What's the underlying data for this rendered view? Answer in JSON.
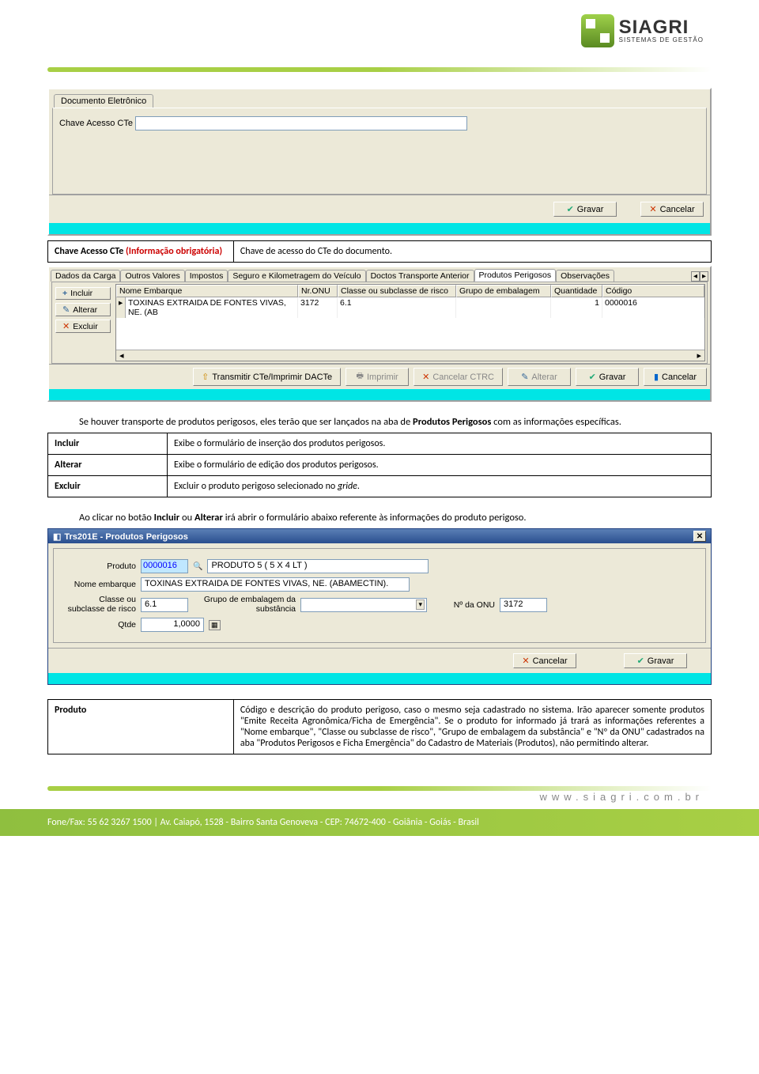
{
  "logo": {
    "name": "SIAGRI",
    "tagline": "SISTEMAS DE GESTÃO"
  },
  "panel1": {
    "tab_label": "Documento Eletrônico",
    "field_label": "Chave Acesso CTe",
    "gravar": "Gravar",
    "cancelar": "Cancelar"
  },
  "table1": {
    "c1a": "Chave Acesso CTe",
    "c1b": "(Informação obrigatória)",
    "c2": "Chave de acesso do CTe do documento."
  },
  "panel2": {
    "tabs": [
      "Dados da Carga",
      "Outros Valores",
      "Impostos",
      "Seguro e Kilometragem do Veículo",
      "Doctos Transporte Anterior",
      "Produtos Perigosos",
      "Observações"
    ],
    "sel_idx": 5,
    "grid_cols": [
      "Nome Embarque",
      "Nr.ONU",
      "Classe ou subclasse de risco",
      "Grupo de embalagem",
      "Quantidade",
      "Código"
    ],
    "row": {
      "nome": "TOXINAS EXTRAIDA DE FONTES VIVAS, NE. (AB",
      "onu": "3172",
      "classe": "6.1",
      "grupo": "",
      "qtde": "1",
      "codigo": "0000016"
    },
    "side": {
      "incluir": "Incluir",
      "alterar": "Alterar",
      "excluir": "Excluir"
    },
    "bottom": {
      "transmitir": "Transmitir CTe/Imprimir DACTe",
      "imprimir": "Imprimir",
      "cancelar_ctrc": "Cancelar CTRC",
      "alterar": "Alterar",
      "gravar": "Gravar",
      "cancelar": "Cancelar"
    }
  },
  "para1": "Se houver transporte de produtos perigosos, eles terão que ser lançados na aba de <b>Produtos Perigosos</b> com as informações específicas.",
  "table2": {
    "r1a": "Incluir",
    "r1b": "Exibe o formulário de inserção dos produtos perigosos.",
    "r2a": "Alterar",
    "r2b": "Exibe o formulário de edição dos produtos perigosos.",
    "r3a": "Excluir",
    "r3b": "Excluir o produto perigoso selecionado no <i>gride</i>."
  },
  "para2": "Ao clicar no botão <b>Incluir</b> ou <b>Alterar</b> irá abrir o formulário abaixo referente às informações do produto perigoso.",
  "dlg": {
    "title": "Trs201E - Produtos Perigosos",
    "produto_lbl": "Produto",
    "produto_cod": "0000016",
    "produto_desc": "PRODUTO 5 ( 5 X 4 LT )",
    "nome_lbl": "Nome embarque",
    "nome_val": "TOXINAS EXTRAIDA DE FONTES VIVAS, NE. (ABAMECTIN).",
    "classe_lbl": "Classe ou subclasse de risco",
    "classe_val": "6.1",
    "grupo_lbl": "Grupo de embalagem da substância",
    "onu_lbl": "Nº da ONU",
    "onu_val": "3172",
    "qtde_lbl": "Qtde",
    "qtde_val": "1,0000",
    "cancelar": "Cancelar",
    "gravar": "Gravar"
  },
  "table3": {
    "c1": "Produto",
    "c2": "Código e descrição do produto perigoso, caso o mesmo seja cadastrado no sistema. Irão aparecer somente produtos \"Emite Receita Agronômica/Ficha de Emergência\". Se o produto for informado já trará as informações referentes a \"Nome embarque\", \"Classe ou subclasse de risco\", \"Grupo de embalagem da substância\" e \"Nº da ONU\" cadastrados na aba \"Produtos Perigosos e Ficha Emergência\" do Cadastro de Materiais (Produtos), não permitindo alterar."
  },
  "footer": {
    "url": "www.siagri.com.br",
    "line": "Fone/Fax: 55 62 3267 1500 | Av. Caiapó, 1528 - Bairro Santa Genoveva - CEP: 74672-400 - Goiânia - Goiás - Brasil"
  }
}
